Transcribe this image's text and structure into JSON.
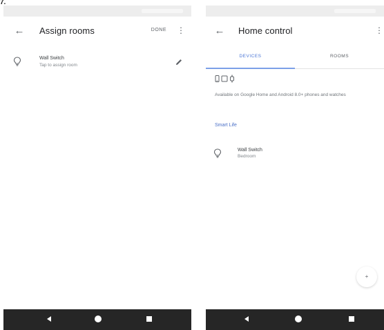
{
  "step_marker": "7.",
  "left_screen": {
    "app_bar": {
      "back_icon": "arrow-back-icon",
      "title": "Assign rooms",
      "action_label": "DONE",
      "overflow_icon": "more-vert-icon"
    },
    "devices": [
      {
        "icon": "lightbulb-icon",
        "name": "Wall Switch",
        "subtitle": "Tap to assign room",
        "action_icon": "edit-pencil-icon"
      }
    ],
    "nav_bar": {
      "back_icon": "nav-back-icon",
      "home_icon": "nav-home-icon",
      "recents_icon": "nav-recents-icon"
    }
  },
  "right_screen": {
    "app_bar": {
      "back_icon": "arrow-back-icon",
      "title": "Home control",
      "overflow_icon": "more-vert-icon"
    },
    "tabs": [
      {
        "label": "DEVICES",
        "active": true
      },
      {
        "label": "ROOMS",
        "active": false
      }
    ],
    "devices_info": {
      "icons": [
        "phone-icon",
        "tablet-icon",
        "watch-icon"
      ],
      "description": "Available on Google Home and Android 8.0+ phones and watches"
    },
    "section_title": "Smart Life",
    "devices": [
      {
        "icon": "lightbulb-icon",
        "name": "Wall Switch",
        "subtitle": "Bedroom"
      }
    ],
    "fab": {
      "icon": "add-icon",
      "label": "+"
    },
    "nav_bar": {
      "back_icon": "nav-back-icon",
      "home_icon": "nav-home-icon",
      "recents_icon": "nav-recents-icon"
    }
  },
  "colors": {
    "accent_blue": "#4a75d6",
    "status_bar": "#ededed",
    "nav_bar": "#262626",
    "text_primary": "#202124",
    "text_secondary": "#80868b"
  }
}
